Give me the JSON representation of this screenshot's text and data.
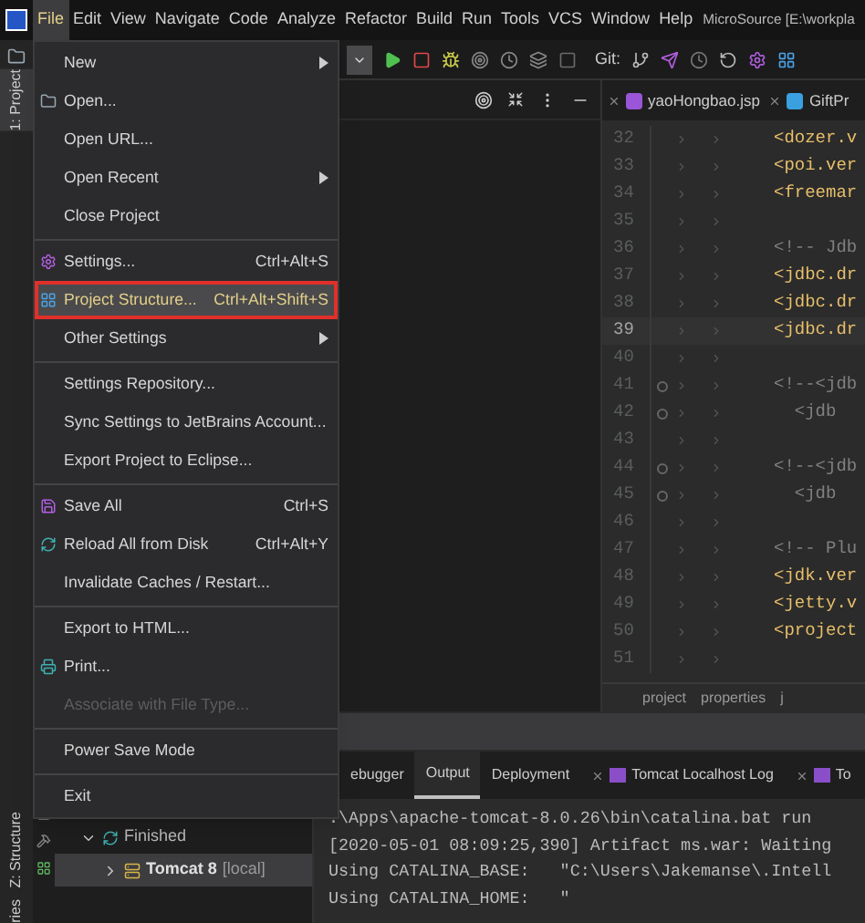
{
  "menubar": {
    "items": [
      {
        "label": "File",
        "selected": true
      },
      {
        "label": "Edit",
        "selected": false
      },
      {
        "label": "View",
        "selected": false
      },
      {
        "label": "Navigate",
        "selected": false
      },
      {
        "label": "Code",
        "selected": false
      },
      {
        "label": "Analyze",
        "selected": false
      },
      {
        "label": "Refactor",
        "selected": false
      },
      {
        "label": "Build",
        "selected": false
      },
      {
        "label": "Run",
        "selected": false
      },
      {
        "label": "Tools",
        "selected": false
      },
      {
        "label": "VCS",
        "selected": false
      },
      {
        "label": "Window",
        "selected": false
      },
      {
        "label": "Help",
        "selected": false
      }
    ],
    "title": "MicroSource [E:\\workpla"
  },
  "left_strip": {
    "tabs": [
      {
        "label": "1: Project",
        "selected": true
      },
      {
        "label": "Z: Structure",
        "selected": false
      },
      {
        "label": "ries",
        "selected": false
      }
    ]
  },
  "file_menu": [
    {
      "kind": "item",
      "label": "New",
      "submenu": true,
      "selected": false,
      "disabled": false
    },
    {
      "kind": "item",
      "label": "Open...",
      "submenu": false,
      "selected": false,
      "disabled": false
    },
    {
      "kind": "item",
      "label": "Open URL...",
      "submenu": false,
      "selected": false,
      "disabled": false
    },
    {
      "kind": "item",
      "label": "Open Recent",
      "submenu": true,
      "selected": false,
      "disabled": false
    },
    {
      "kind": "item",
      "label": "Close Project",
      "submenu": false,
      "selected": false,
      "disabled": false
    },
    {
      "kind": "separator"
    },
    {
      "kind": "item",
      "label": "Settings...",
      "shortcut": "Ctrl+Alt+S",
      "submenu": false,
      "selected": false,
      "disabled": false
    },
    {
      "kind": "item",
      "label": "Project Structure...",
      "shortcut": "Ctrl+Alt+Shift+S",
      "submenu": false,
      "selected": true,
      "disabled": false
    },
    {
      "kind": "item",
      "label": "Other Settings",
      "submenu": true,
      "selected": false,
      "disabled": false
    },
    {
      "kind": "separator"
    },
    {
      "kind": "item",
      "label": "Settings Repository...",
      "submenu": false,
      "selected": false,
      "disabled": false
    },
    {
      "kind": "item",
      "label": "Sync Settings to JetBrains Account...",
      "submenu": false,
      "selected": false,
      "disabled": false
    },
    {
      "kind": "item",
      "label": "Export Project to Eclipse...",
      "submenu": false,
      "selected": false,
      "disabled": false
    },
    {
      "kind": "separator"
    },
    {
      "kind": "item",
      "label": "Save All",
      "shortcut": "Ctrl+S",
      "submenu": false,
      "selected": false,
      "disabled": false
    },
    {
      "kind": "item",
      "label": "Reload All from Disk",
      "shortcut": "Ctrl+Alt+Y",
      "submenu": false,
      "selected": false,
      "disabled": false
    },
    {
      "kind": "item",
      "label": "Invalidate Caches / Restart...",
      "submenu": false,
      "selected": false,
      "disabled": false
    },
    {
      "kind": "separator"
    },
    {
      "kind": "item",
      "label": "Export to HTML...",
      "submenu": false,
      "selected": false,
      "disabled": false
    },
    {
      "kind": "item",
      "label": "Print...",
      "submenu": false,
      "selected": false,
      "disabled": false
    },
    {
      "kind": "item",
      "label": "Associate with File Type...",
      "submenu": false,
      "selected": false,
      "disabled": true
    },
    {
      "kind": "separator"
    },
    {
      "kind": "item",
      "label": "Power Save Mode",
      "submenu": false,
      "selected": false,
      "disabled": false
    },
    {
      "kind": "separator"
    },
    {
      "kind": "item",
      "label": "Exit",
      "submenu": false,
      "selected": false,
      "disabled": false
    }
  ],
  "toolbar": {
    "git_label": "Git:"
  },
  "editor_tabs": [
    {
      "label": "yaoHongbao.jsp"
    },
    {
      "label": "GiftPr"
    }
  ],
  "editor_lines": [
    {
      "number": "32",
      "code": "<dozer.v",
      "kind": "tag",
      "current": false,
      "fold": false
    },
    {
      "number": "33",
      "code": "<poi.ver",
      "kind": "tag",
      "current": false,
      "fold": false
    },
    {
      "number": "34",
      "code": "<freemar",
      "kind": "tag",
      "current": false,
      "fold": false
    },
    {
      "number": "35",
      "kind": "blank",
      "current": false,
      "fold": false
    },
    {
      "number": "36",
      "code": "<!-- Jdb",
      "kind": "comment",
      "current": false,
      "fold": false
    },
    {
      "number": "37",
      "code": "<jdbc.dr",
      "kind": "tag",
      "current": false,
      "fold": false
    },
    {
      "number": "38",
      "code": "<jdbc.dr",
      "kind": "tag",
      "current": false,
      "fold": false
    },
    {
      "number": "39",
      "code": "<jdbc.dr",
      "kind": "tag",
      "current": true,
      "fold": false
    },
    {
      "number": "40",
      "kind": "blank",
      "current": false,
      "fold": false
    },
    {
      "number": "41",
      "code": "<!--<jdb",
      "kind": "comment",
      "current": false,
      "fold": true
    },
    {
      "number": "42",
      "code": "  <jdb",
      "kind": "comment",
      "current": false,
      "fold": true
    },
    {
      "number": "43",
      "kind": "blank",
      "current": false,
      "fold": false
    },
    {
      "number": "44",
      "code": "<!--<jdb",
      "kind": "comment",
      "current": false,
      "fold": true
    },
    {
      "number": "45",
      "code": "  <jdb",
      "kind": "comment",
      "current": false,
      "fold": true
    },
    {
      "number": "46",
      "kind": "blank",
      "current": false,
      "fold": false
    },
    {
      "number": "47",
      "code": "<!-- Plu",
      "kind": "comment",
      "current": false,
      "fold": false
    },
    {
      "number": "48",
      "code": "<jdk.ver",
      "kind": "tag",
      "current": false,
      "fold": false
    },
    {
      "number": "49",
      "code": "<jetty.v",
      "kind": "tag",
      "current": false,
      "fold": false
    },
    {
      "number": "50",
      "code": "<project",
      "kind": "tag",
      "current": false,
      "fold": false
    },
    {
      "number": "51",
      "kind": "blank",
      "current": false,
      "fold": false
    }
  ],
  "breadcrumb": [
    "project",
    "properties",
    "j"
  ],
  "bottom_tabs": [
    {
      "label": "ebugger",
      "selected": false,
      "closable": false
    },
    {
      "label": "Output",
      "selected": true,
      "closable": false
    },
    {
      "label": "Deployment",
      "selected": false,
      "closable": false
    },
    {
      "label": "Tomcat Localhost Log",
      "selected": false,
      "closable": true
    },
    {
      "label": "To",
      "selected": false,
      "closable": true
    }
  ],
  "services_tree": [
    {
      "label": "Finished",
      "expanded": true,
      "selected": false,
      "children": [
        {
          "label": "Tomcat 8",
          "suffix": "[local]",
          "expanded": false,
          "selected": true
        }
      ]
    }
  ],
  "console_lines": [
    ":\\Apps\\apache-tomcat-8.0.26\\bin\\catalina.bat run",
    "[2020-05-01 08:09:25,390] Artifact ms.war: Waiting",
    "Using CATALINA_BASE:   \"C:\\Users\\Jakemanse\\.Intell",
    "Using CATALINA_HOME:   \""
  ]
}
